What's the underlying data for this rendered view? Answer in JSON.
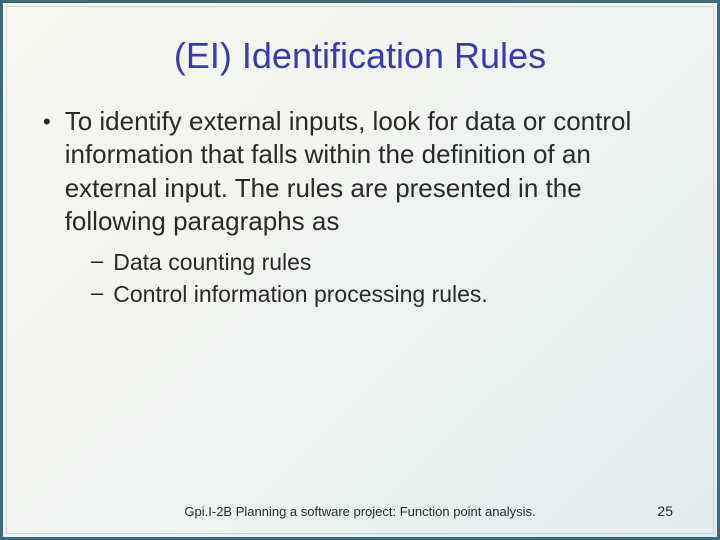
{
  "title": "(EI) Identification Rules",
  "main_bullet": "To identify external inputs, look for data or control information that falls within the definition of an external input.  The rules are presented in the following paragraphs as",
  "sub_bullets": [
    "Data counting rules",
    "Control information processing rules."
  ],
  "footer": "Gpi.I-2B Planning a software project: Function point analysis.",
  "page_number": "25"
}
